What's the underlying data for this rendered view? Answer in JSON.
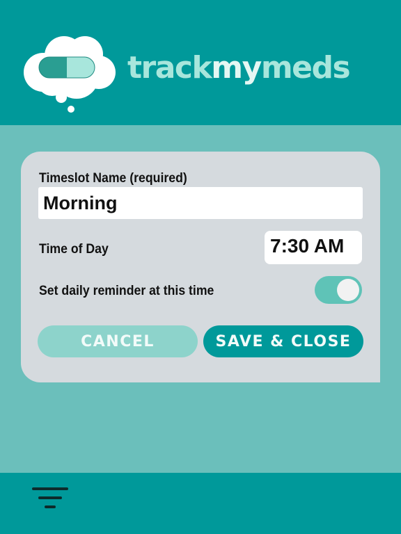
{
  "brand": {
    "part1": "track",
    "part2": "my",
    "part3": "meds"
  },
  "form": {
    "name_label": "Timeslot Name (required)",
    "name_value": "Morning",
    "time_label": "Time of Day",
    "time_value": "7:30 AM",
    "reminder_label": "Set daily reminder at this time",
    "reminder_enabled": true
  },
  "buttons": {
    "cancel": "CANCEL",
    "save": "SAVE & CLOSE"
  },
  "icons": {
    "logo": "cloud-pill-icon",
    "footer": "filter-icon"
  },
  "colors": {
    "primary": "#00999a",
    "background": "#6bbfbb",
    "accent": "#8dd3cb",
    "card": "#d5dade"
  }
}
